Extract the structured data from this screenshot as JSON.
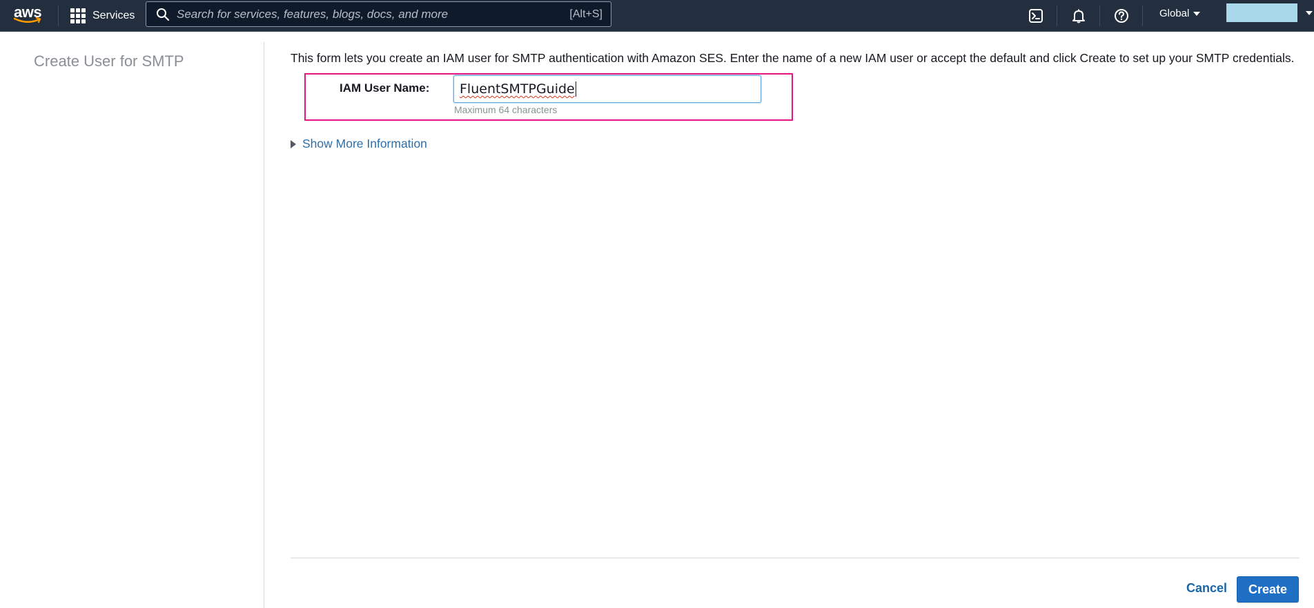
{
  "topnav": {
    "logo_text": "aws",
    "services_label": "Services",
    "search": {
      "placeholder": "Search for services, features, blogs, docs, and more",
      "shortcut": "[Alt+S]"
    },
    "region_label": "Global",
    "icons": [
      "cloudshell-icon",
      "notifications-bell-icon",
      "help-icon"
    ],
    "colors": {
      "background": "#232f3e",
      "account_block": "#a8d8ea"
    }
  },
  "sidebar": {
    "title": "Create User for SMTP"
  },
  "form": {
    "intro": "This form lets you create an IAM user for SMTP authentication with Amazon SES. Enter the name of a new IAM user or accept the default and click Create to set up your SMTP credentials.",
    "iam_user_name_label": "IAM User Name:",
    "iam_user_name_value": "FluentSMTPGuide",
    "hint": "Maximum 64 characters",
    "show_more_label": "Show More Information",
    "highlight_color": "#e6157f"
  },
  "actions": {
    "cancel_label": "Cancel",
    "create_label": "Create",
    "create_color": "#1f6fc5"
  }
}
